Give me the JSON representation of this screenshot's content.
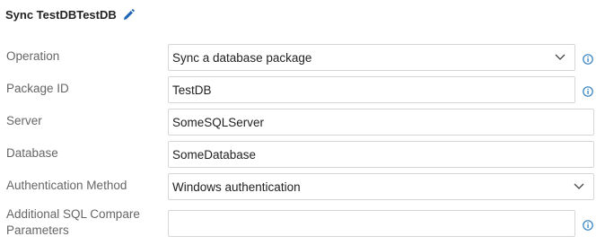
{
  "header": {
    "title": "Sync TestDBTestDB",
    "edit_icon": "pencil-icon"
  },
  "form": {
    "operation": {
      "label": "Operation",
      "value": "Sync a database package",
      "has_info": true
    },
    "package_id": {
      "label": "Package ID",
      "value": "TestDB",
      "has_info": true
    },
    "server": {
      "label": "Server",
      "value": "SomeSQLServer"
    },
    "database": {
      "label": "Database",
      "value": "SomeDatabase"
    },
    "auth_method": {
      "label": "Authentication Method",
      "value": "Windows authentication"
    },
    "additional_params": {
      "label_line1": "Additional SQL Compare",
      "label_line2": "Parameters",
      "value": "",
      "has_info": true
    }
  },
  "colors": {
    "info_blue": "#2f7fc1",
    "pencil_blue": "#1e66b3"
  }
}
